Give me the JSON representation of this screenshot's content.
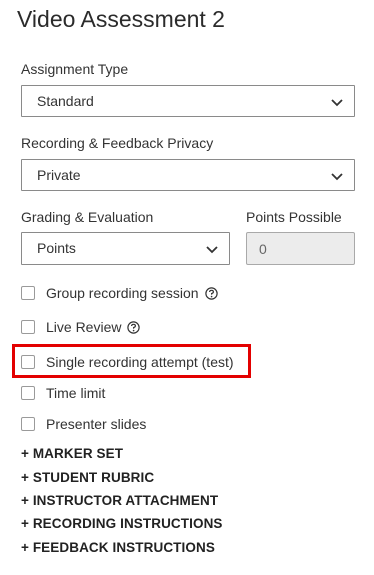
{
  "page": {
    "title": "Video Assessment 2"
  },
  "assignment_type": {
    "label": "Assignment Type",
    "value": "Standard"
  },
  "privacy": {
    "label": "Recording & Feedback Privacy",
    "value": "Private"
  },
  "grading": {
    "label": "Grading & Evaluation",
    "value": "Points"
  },
  "points": {
    "label": "Points Possible",
    "value": "0"
  },
  "options": [
    {
      "label": "Group recording session",
      "has_help": true,
      "checked": false
    },
    {
      "label": "Live Review",
      "has_help": true,
      "checked": false
    },
    {
      "label": "Single recording attempt (test)",
      "has_help": false,
      "checked": false,
      "highlighted": true
    },
    {
      "label": "Time limit",
      "has_help": false,
      "checked": false
    },
    {
      "label": "Presenter slides",
      "has_help": false,
      "checked": false
    }
  ],
  "sections": [
    "+ MARKER SET",
    "+ STUDENT RUBRIC",
    "+ INSTRUCTOR ATTACHMENT",
    "+ RECORDING INSTRUCTIONS",
    "+ FEEDBACK INSTRUCTIONS"
  ],
  "colors": {
    "highlight": "#e30000",
    "disabled_bg": "#ececec"
  }
}
